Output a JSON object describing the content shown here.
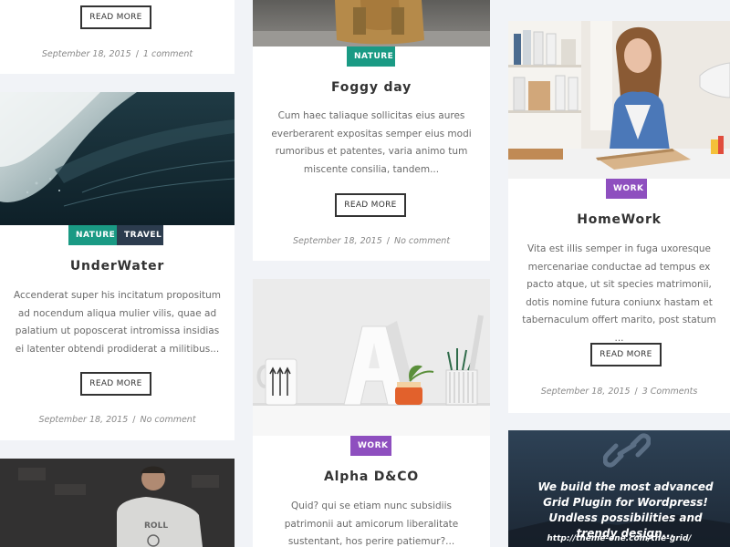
{
  "colors": {
    "nature": "#1a9a84",
    "travel": "#2c3c4e",
    "work": "#8e4fbf",
    "background": "#f1f3f7"
  },
  "cards": {
    "top_left": {
      "button": "READ MORE",
      "date": "September 18, 2015",
      "comments": "1 comment"
    },
    "underwater": {
      "tags": [
        "NATURE",
        "TRAVEL"
      ],
      "title": "UnderWater",
      "excerpt": "Accenderat super his incitatum propositum ad nocendum aliqua mulier vilis, quae ad palatium ut poposcerat intromissa insidias ei latenter obtendi prodiderat a militibus...",
      "button": "READ MORE",
      "date": "September 18, 2015",
      "comments": "No comment"
    },
    "foggy": {
      "tags": [
        "NATURE"
      ],
      "title": "Foggy day",
      "excerpt": "Cum haec taliaque sollicitas eius aures everberarent expositas semper eius modi rumoribus et patentes, varia animo tum miscente consilia, tandem...",
      "button": "READ MORE",
      "date": "September 18, 2015",
      "comments": "No comment"
    },
    "alpha": {
      "tags": [
        "WORK"
      ],
      "title": "Alpha D&CO",
      "excerpt": "Quid? qui se etiam nunc subsidiis patrimonii aut amicorum liberalitate sustentant, hos perire patiemur?..."
    },
    "homework": {
      "tags": [
        "WORK"
      ],
      "title": "HomeWork",
      "excerpt": "Vita est illis semper in fuga uxoresque mercenariae conductae ad tempus ex pacto atque, ut sit species matrimonii, dotis nomine futura coniunx hastam et tabernaculum offert marito, post statum ...",
      "button": "READ MORE",
      "date": "September 18, 2015",
      "comments": "3 Comments"
    },
    "promo": {
      "text": "We build the most advanced Grid Plugin for Wordpress! Undless possibilities and trendy design...",
      "url": "http://theme-one.com/the-grid/"
    }
  }
}
